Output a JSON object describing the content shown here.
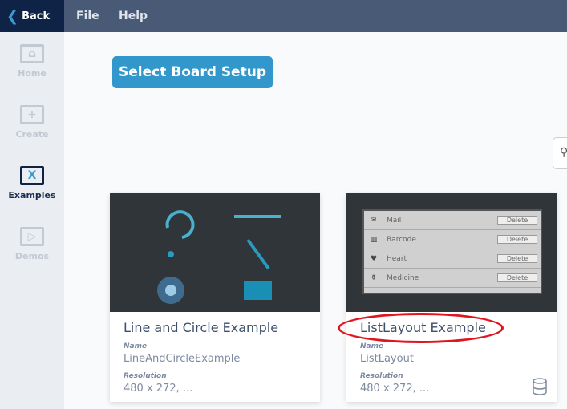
{
  "topbar": {
    "back": "Back",
    "menu": [
      "File",
      "Help"
    ]
  },
  "sidebar": [
    {
      "label": "Home",
      "icon": "⌂"
    },
    {
      "label": "Create",
      "icon": "+"
    },
    {
      "label": "Examples",
      "icon": "X"
    },
    {
      "label": "Demos",
      "icon": "▷"
    }
  ],
  "main": {
    "select_button": "Select Board Setup"
  },
  "cards": [
    {
      "title": "Line and Circle Example",
      "name_label": "Name",
      "name": "LineAndCircleExample",
      "res_label": "Resolution",
      "resolution": "480 x 272, ..."
    },
    {
      "title": "ListLayout Example",
      "name_label": "Name",
      "name": "ListLayout",
      "res_label": "Resolution",
      "resolution": "480 x 272, ...",
      "preview": [
        {
          "label": "Mail",
          "icon": "✉"
        },
        {
          "label": "Barcode",
          "icon": "▥"
        },
        {
          "label": "Heart",
          "icon": "♥"
        },
        {
          "label": "Medicine",
          "icon": "⚱"
        }
      ],
      "delete": "Delete"
    }
  ]
}
